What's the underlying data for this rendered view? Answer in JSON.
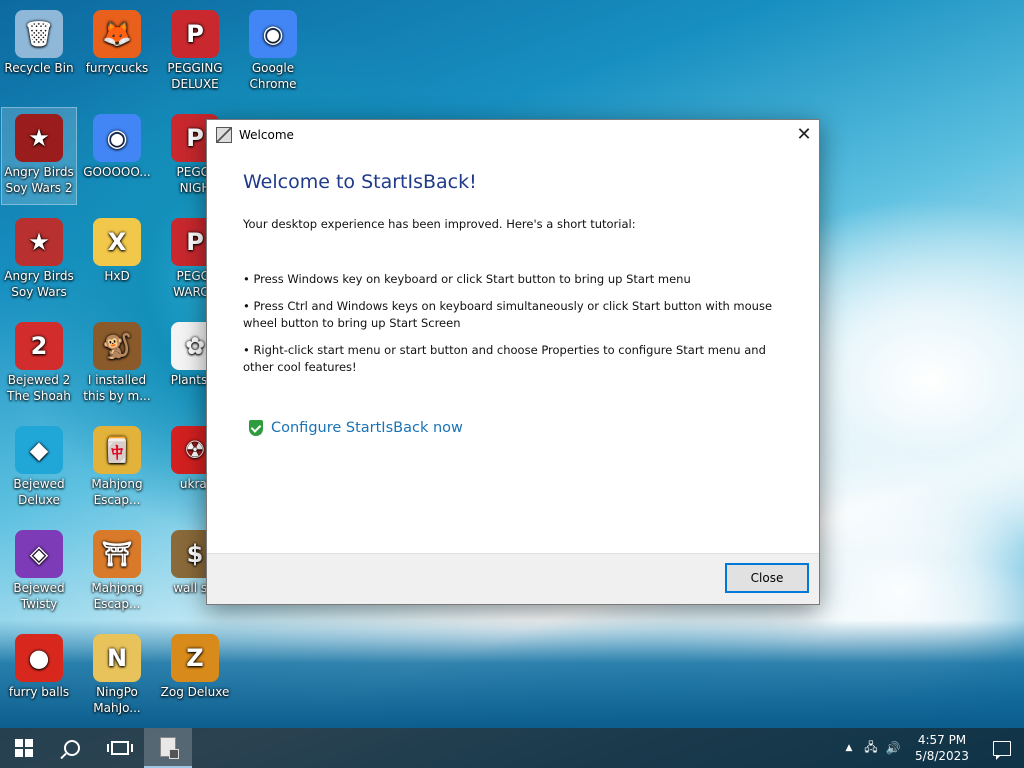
{
  "desktop": {
    "icons": [
      {
        "label": "Recycle Bin",
        "icon": "recycle-bin-icon",
        "color": "#8fb8d8",
        "glyph": "🗑"
      },
      {
        "label": "furrycucks",
        "icon": "firefox-icon",
        "color": "#e8601c",
        "glyph": "🦊"
      },
      {
        "label": "PEGGING DELUXE",
        "icon": "pegging-icon",
        "color": "#c8282e",
        "glyph": "P"
      },
      {
        "label": "Google Chrome",
        "icon": "chrome-icon",
        "color": "#4285f4",
        "glyph": "◉"
      },
      {
        "label": "Angry Birds Soy Wars 2",
        "icon": "angry-birds-star-wars-icon",
        "color": "#9b1c1c",
        "glyph": "★"
      },
      {
        "label": "GOOOOO...",
        "icon": "chrome-icon",
        "color": "#4285f4",
        "glyph": "◉"
      },
      {
        "label": "PEGGI NIGH",
        "icon": "pegging-icon",
        "color": "#c8282e",
        "glyph": "P"
      },
      {
        "label": "Angry Birds Soy Wars",
        "icon": "angry-birds-star-wars-icon",
        "color": "#b83030",
        "glyph": "★"
      },
      {
        "label": "HxD",
        "icon": "hxd-icon",
        "color": "#f2c84b",
        "glyph": "X"
      },
      {
        "label": "PEGGI WARCR",
        "icon": "pegging-icon",
        "color": "#c8282e",
        "glyph": "P"
      },
      {
        "label": "Bejewed 2 The Shoah",
        "icon": "bejeweled-2-icon",
        "color": "#d22c2c",
        "glyph": "2"
      },
      {
        "label": "I installed this by m...",
        "icon": "monkey-icon",
        "color": "#8a5a2b",
        "glyph": "🐒"
      },
      {
        "label": "Plants V",
        "icon": "plants-icon",
        "color": "#f4f4f4",
        "glyph": "✿"
      },
      {
        "label": "Bejewed Deluxe",
        "icon": "bejeweled-deluxe-icon",
        "color": "#21a6d8",
        "glyph": "◆"
      },
      {
        "label": "Mahjong Escap...",
        "icon": "mahjong-icon",
        "color": "#e2b23a",
        "glyph": "🀄"
      },
      {
        "label": "ukrai",
        "icon": "radiation-icon",
        "color": "#d32020",
        "glyph": "☢"
      },
      {
        "label": "Bejewed Twisty",
        "icon": "bejeweled-twist-icon",
        "color": "#7d3bb8",
        "glyph": "◈"
      },
      {
        "label": "Mahjong Escap...",
        "icon": "mahjong-gate-icon",
        "color": "#d87a2a",
        "glyph": "⛩"
      },
      {
        "label": "wall str",
        "icon": "money-bag-icon",
        "color": "#8a6a3a",
        "glyph": "$"
      },
      {
        "label": "furry balls",
        "icon": "furry-ball-icon",
        "color": "#d8281e",
        "glyph": "●"
      },
      {
        "label": "NingPo MahJo...",
        "icon": "ningpo-icon",
        "color": "#e8c25a",
        "glyph": "N"
      },
      {
        "label": "Zog Deluxe",
        "icon": "zog-icon",
        "color": "#d88a1a",
        "glyph": "Z"
      }
    ]
  },
  "dialog": {
    "title": "Welcome",
    "heading": "Welcome to StartIsBack!",
    "intro": "Your desktop experience has been improved. Here's a short tutorial:",
    "bullets": [
      "• Press Windows key on keyboard or click Start button to bring up Start menu",
      "• Press Ctrl and Windows keys on keyboard simultaneously or click Start button with mouse wheel button to bring up Start Screen",
      "• Right-click start menu or start button and choose Properties to configure Start menu and other cool features!"
    ],
    "configure_link": "Configure StartIsBack now",
    "close_button": "Close",
    "accent_color": "#1f3a8a",
    "link_color": "#1a73b5"
  },
  "taskbar": {
    "time": "4:57 PM",
    "date": "5/8/2023",
    "tray_up_arrow": "▲",
    "network": "🖧",
    "volume": "🔊"
  }
}
